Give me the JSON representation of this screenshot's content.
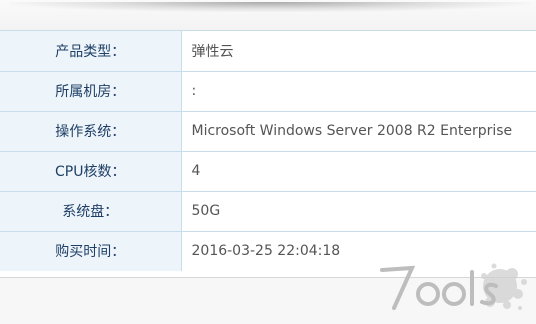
{
  "rows": [
    {
      "label": "产品类型：",
      "value": "弹性云"
    },
    {
      "label": "所属机房：",
      "value": ":"
    },
    {
      "label": "操作系统：",
      "value": "Microsoft Windows Server 2008 R2 Enterprise"
    },
    {
      "label": "CPU核数：",
      "value": "4"
    },
    {
      "label": "系统盘：",
      "value": "50G"
    },
    {
      "label": "购买时间：",
      "value": "2016-03-25 22:04:18"
    }
  ],
  "watermark": {
    "text": "7ools"
  },
  "colors": {
    "label_bg": "#edf4fa",
    "label_text": "#1f3f66",
    "value_text": "#555555",
    "border": "#c9dce9"
  }
}
